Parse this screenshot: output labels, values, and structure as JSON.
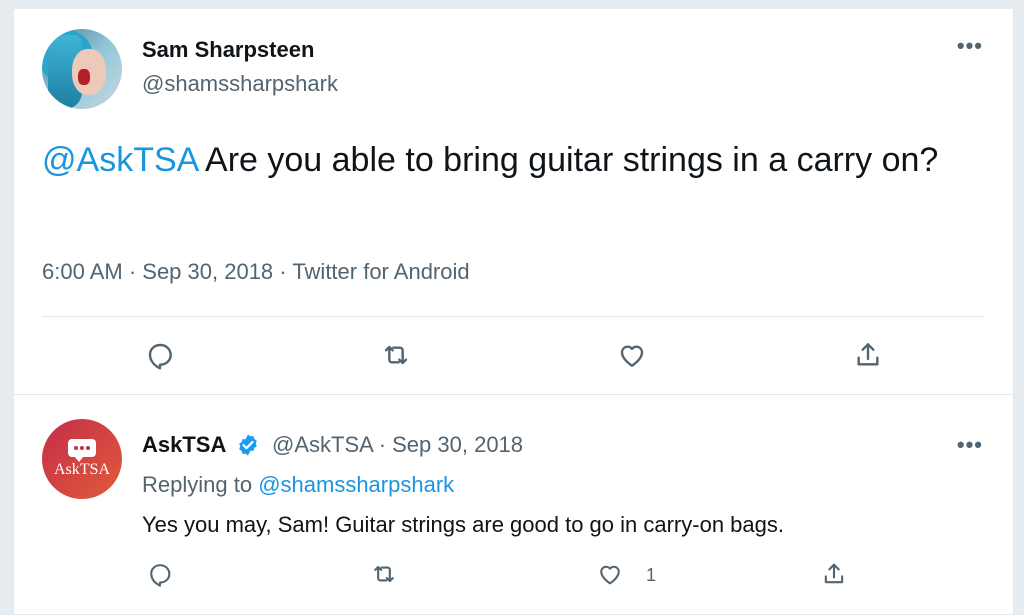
{
  "main_tweet": {
    "author_name": "Sam Sharpsteen",
    "author_handle": "@shamssharpshark",
    "mention": "@AskTSA",
    "text": " Are you able to bring guitar strings in a carry on?",
    "meta": "6:00 AM · Sep 30, 2018 · Twitter for Android",
    "more_label": "•••"
  },
  "reply_tweet": {
    "author_name": "AskTSA",
    "author_handle_date": "@AskTSA · Sep 30, 2018",
    "replying_prefix": "Replying to ",
    "replying_to": "@shamssharpshark",
    "text": "Yes you may, Sam! Guitar strings are good to go in carry-on bags.",
    "like_count": "1",
    "avatar_text": "AskTSA",
    "more_label": "•••"
  },
  "colors": {
    "link": "#1b95e0",
    "secondary_text": "#536471",
    "primary_text": "#0f1419",
    "verified": "#1d9bf0",
    "asktsa_avatar": "#c52d49"
  }
}
